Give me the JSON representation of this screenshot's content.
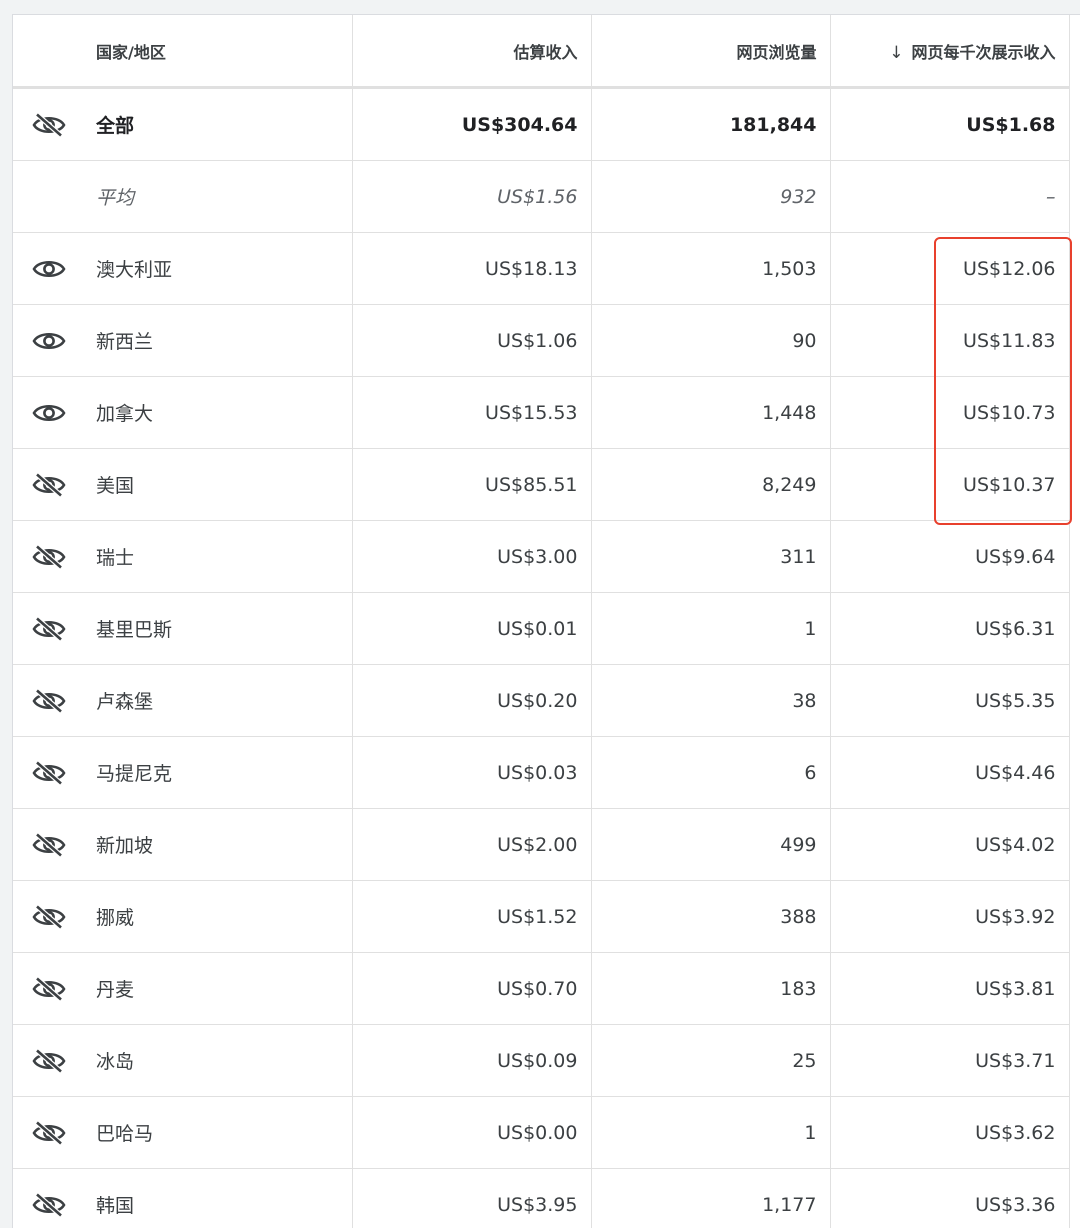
{
  "headers": {
    "country": "国家/地区",
    "revenue": "估算收入",
    "pageviews": "网页浏览量",
    "rpm": "网页每千次展示收入",
    "sort_arrow": "↓"
  },
  "total": {
    "name": "全部",
    "revenue": "US$304.64",
    "pageviews": "181,844",
    "rpm": "US$1.68",
    "visible": false
  },
  "average": {
    "name": "平均",
    "revenue": "US$1.56",
    "pageviews": "932",
    "rpm": "–"
  },
  "rows": [
    {
      "name": "澳大利亚",
      "revenue": "US$18.13",
      "pageviews": "1,503",
      "rpm": "US$12.06",
      "visible": true
    },
    {
      "name": "新西兰",
      "revenue": "US$1.06",
      "pageviews": "90",
      "rpm": "US$11.83",
      "visible": true
    },
    {
      "name": "加拿大",
      "revenue": "US$15.53",
      "pageviews": "1,448",
      "rpm": "US$10.73",
      "visible": true
    },
    {
      "name": "美国",
      "revenue": "US$85.51",
      "pageviews": "8,249",
      "rpm": "US$10.37",
      "visible": false
    },
    {
      "name": "瑞士",
      "revenue": "US$3.00",
      "pageviews": "311",
      "rpm": "US$9.64",
      "visible": false
    },
    {
      "name": "基里巴斯",
      "revenue": "US$0.01",
      "pageviews": "1",
      "rpm": "US$6.31",
      "visible": false
    },
    {
      "name": "卢森堡",
      "revenue": "US$0.20",
      "pageviews": "38",
      "rpm": "US$5.35",
      "visible": false
    },
    {
      "name": "马提尼克",
      "revenue": "US$0.03",
      "pageviews": "6",
      "rpm": "US$4.46",
      "visible": false
    },
    {
      "name": "新加坡",
      "revenue": "US$2.00",
      "pageviews": "499",
      "rpm": "US$4.02",
      "visible": false
    },
    {
      "name": "挪威",
      "revenue": "US$1.52",
      "pageviews": "388",
      "rpm": "US$3.92",
      "visible": false
    },
    {
      "name": "丹麦",
      "revenue": "US$0.70",
      "pageviews": "183",
      "rpm": "US$3.81",
      "visible": false
    },
    {
      "name": "冰岛",
      "revenue": "US$0.09",
      "pageviews": "25",
      "rpm": "US$3.71",
      "visible": false
    },
    {
      "name": "巴哈马",
      "revenue": "US$0.00",
      "pageviews": "1",
      "rpm": "US$3.62",
      "visible": false
    },
    {
      "name": "韩国",
      "revenue": "US$3.95",
      "pageviews": "1,177",
      "rpm": "US$3.36",
      "visible": false
    }
  ],
  "colors": {
    "highlight": "#e8402d",
    "icon": "#3c4043"
  }
}
